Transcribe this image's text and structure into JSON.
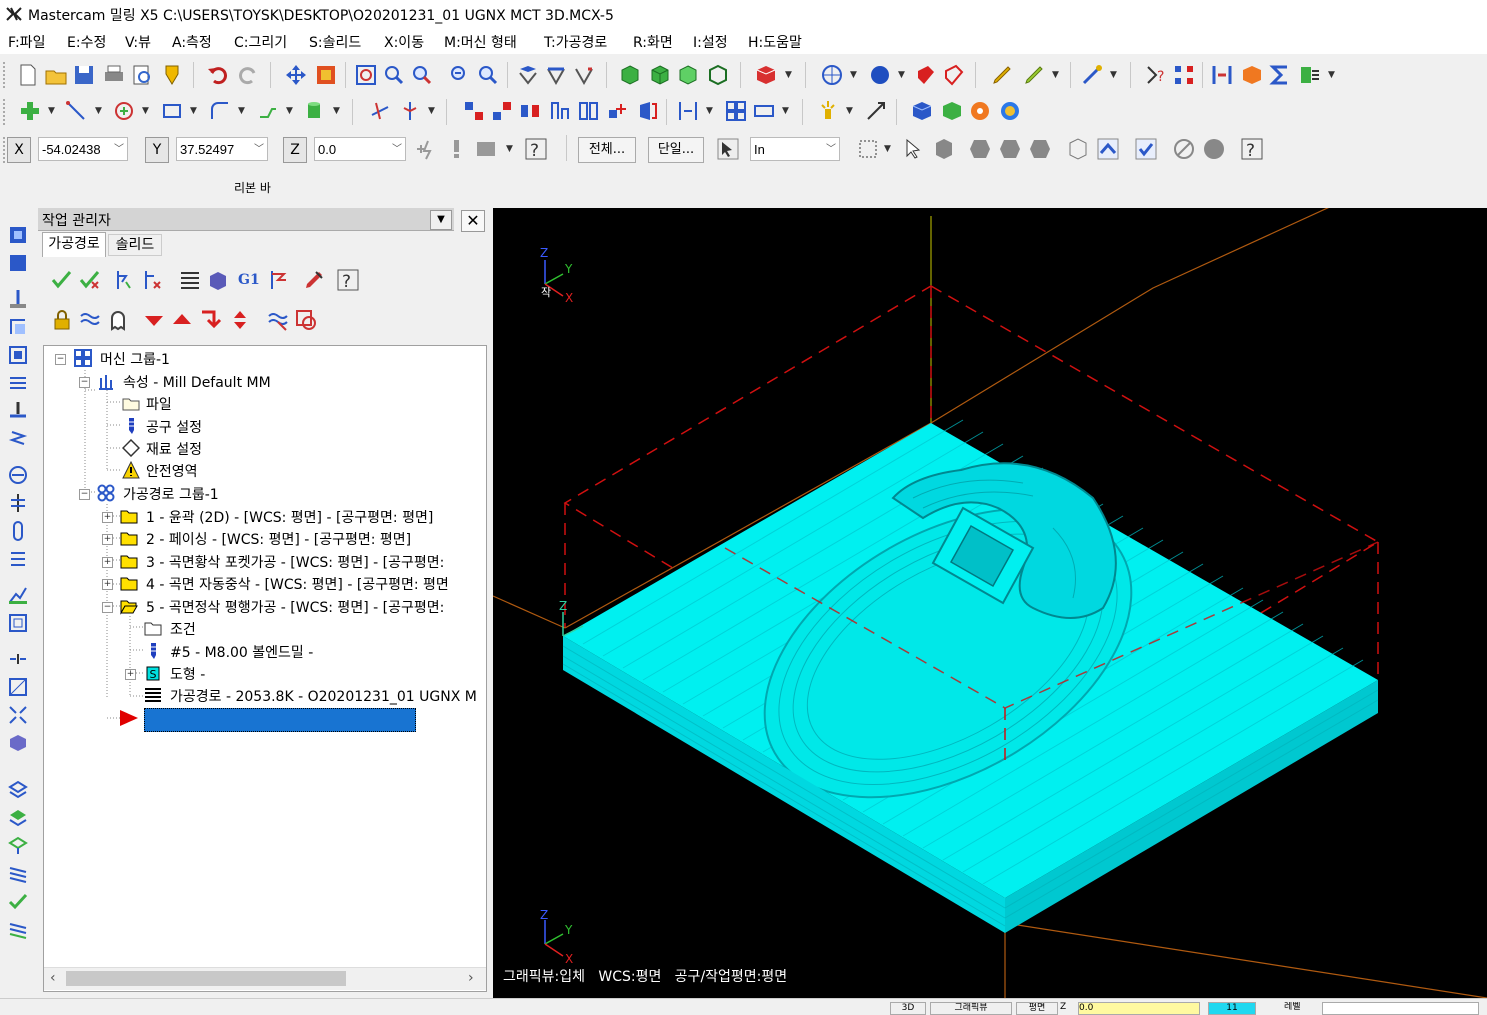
{
  "window": {
    "title": "Mastercam 밀링 X5  C:\\USERS\\TOYSK\\DESKTOP\\O20201231_01 UGNX MCT 3D.MCX-5"
  },
  "menu": [
    {
      "label": "F:파일"
    },
    {
      "label": "E:수정"
    },
    {
      "label": "V:뷰"
    },
    {
      "label": "A:측정"
    },
    {
      "label": "C:그리기"
    },
    {
      "label": "S:솔리드"
    },
    {
      "label": "X:이동"
    },
    {
      "label": "M:머신 형태"
    },
    {
      "label": "T:가공경로"
    },
    {
      "label": "R:화면"
    },
    {
      "label": "I:설정"
    },
    {
      "label": "H:도움말"
    }
  ],
  "coords": {
    "x_label": "X",
    "x_value": "-54.02438",
    "y_label": "Y",
    "y_value": "37.52497",
    "z_label": "Z",
    "z_value": "0.0"
  },
  "ribbon": {
    "all_button": "전체...",
    "single_button": "단일...",
    "unit_select": "In",
    "label": "리본 바"
  },
  "op_manager": {
    "title": "작업 관리자",
    "tabs": [
      {
        "label": "가공경로"
      },
      {
        "label": "솔리드"
      }
    ],
    "g1_label": "G1",
    "tree": [
      {
        "text": "머신 그룹-1"
      },
      {
        "text": "속성 - Mill Default MM"
      },
      {
        "text": "파일"
      },
      {
        "text": "공구 설정"
      },
      {
        "text": "재료 설정"
      },
      {
        "text": "안전영역"
      },
      {
        "text": "가공경로 그룹-1"
      },
      {
        "text": "1 - 윤곽 (2D) - [WCS: 평면] - [공구평면: 평면]"
      },
      {
        "text": "2 - 페이싱 - [WCS: 평면] - [공구평면: 평면]"
      },
      {
        "text": "3 - 곡면황삭 포켓가공 - [WCS: 평면] - [공구평면:"
      },
      {
        "text": "4 - 곡면 자동중삭 - [WCS: 평면] - [공구평면: 평면"
      },
      {
        "text": "5 - 곡면정삭 평행가공 - [WCS: 평면] - [공구평면:"
      },
      {
        "text": "조건"
      },
      {
        "text": "#5 - M8.00 볼엔드밀 -"
      },
      {
        "text": "도형 -"
      },
      {
        "text": "가공경로 - 2053.8K - O20201231_01 UGNX M"
      }
    ]
  },
  "viewport": {
    "status": "그래픽뷰:입체   WCS:평면   공구/작업평면:평면",
    "axis_z": "Z",
    "axis_y": "Y",
    "axis_x": "X",
    "origin_mark": "작",
    "part_color": "#00f0f0",
    "background": "#000000"
  },
  "statusbar": {
    "items": [
      "3D",
      "그래픽뷰",
      "평면",
      "Z",
      "0.0",
      "11",
      "레벨"
    ]
  }
}
